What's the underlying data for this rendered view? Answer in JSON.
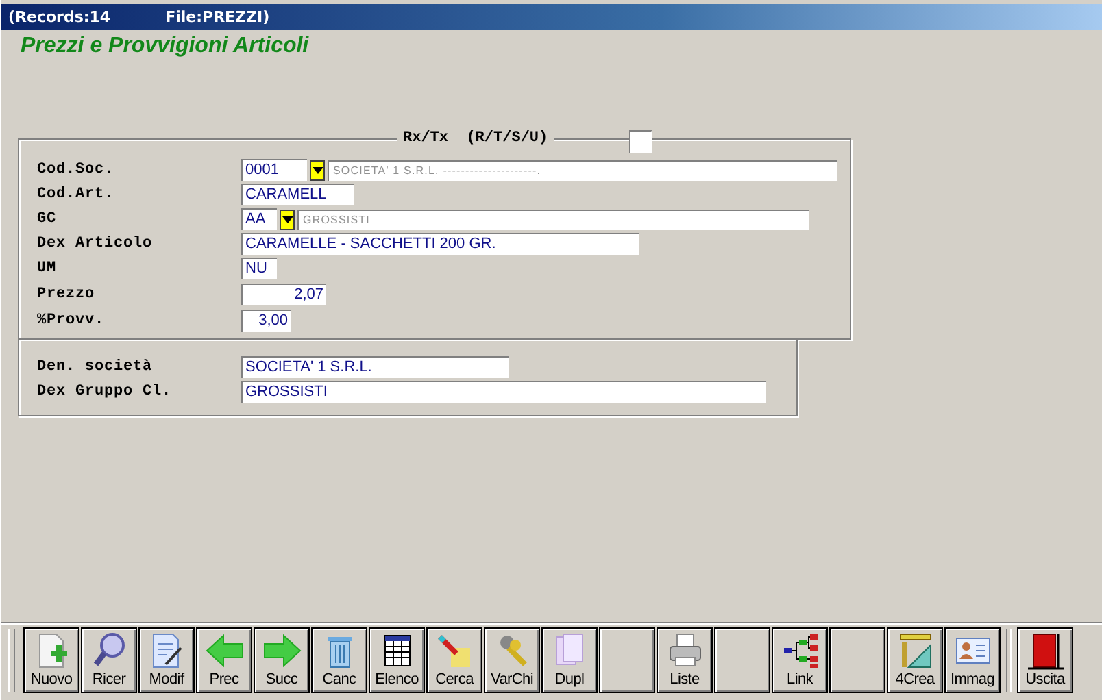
{
  "title_bar": {
    "records": "(Records:14",
    "file": "File:PREZZI)"
  },
  "heading": "Prezzi e Provvigioni Articoli",
  "rxtx": {
    "label": "Rx/Tx  (R/T/S/U)"
  },
  "fields": [
    {
      "label": "Cod.Soc.",
      "kind": "lookup",
      "value": "0001",
      "description": "SOCIETA' 1 S.R.L. ---------------------."
    },
    {
      "label": "Cod.Art.",
      "kind": "text",
      "value": "CARAMELL"
    },
    {
      "label": "GC",
      "kind": "lookup",
      "value": "AA",
      "description": "GROSSISTI"
    },
    {
      "label": "Dex Articolo",
      "kind": "text",
      "value": "CARAMELLE - SACCHETTI 200 GR."
    },
    {
      "label": "UM",
      "kind": "text",
      "value": "NU"
    },
    {
      "label": "Prezzo",
      "kind": "number",
      "value": "2,07"
    },
    {
      "label": "%Provv.",
      "kind": "number",
      "value": "3,00"
    }
  ],
  "summary_fields": [
    {
      "label": "Den. società",
      "value": "SOCIETA' 1 S.R.L."
    },
    {
      "label": "Dex Gruppo Cl.",
      "value": "GROSSISTI"
    }
  ],
  "toolbar": [
    {
      "kind": "command",
      "label": "Nuovo"
    },
    {
      "kind": "command",
      "label": "Ricer"
    },
    {
      "kind": "command",
      "label": "Modif"
    },
    {
      "kind": "command",
      "label": "Prec"
    },
    {
      "kind": "command",
      "label": "Succ"
    },
    {
      "kind": "command",
      "label": "Canc"
    },
    {
      "kind": "command",
      "label": "Elenco"
    },
    {
      "kind": "command",
      "label": "Cerca"
    },
    {
      "kind": "command",
      "label": "VarChi"
    },
    {
      "kind": "command",
      "label": "Dupl"
    },
    {
      "kind": "blank"
    },
    {
      "kind": "command",
      "label": "Liste"
    },
    {
      "kind": "blank"
    },
    {
      "kind": "command",
      "label": "Link"
    },
    {
      "kind": "blank"
    },
    {
      "kind": "command",
      "label": "4Crea"
    },
    {
      "kind": "command",
      "label": "Immag"
    },
    {
      "kind": "exit",
      "label": "Uscita"
    }
  ]
}
